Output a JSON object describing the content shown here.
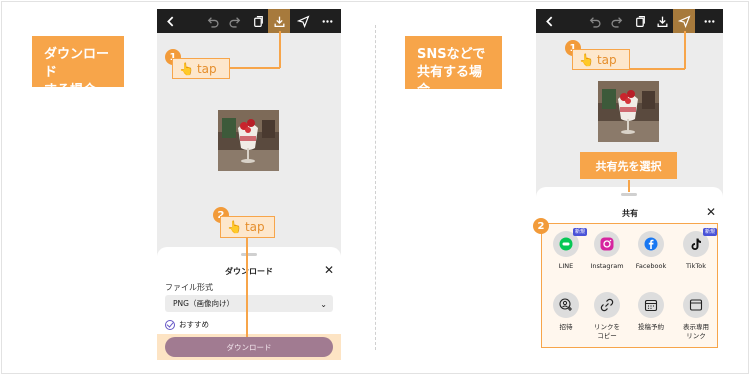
{
  "left_panel": {
    "title_line1": "ダウンロード",
    "title_line2": "する場合",
    "step1": "1",
    "step2": "2",
    "tap_label": "tap",
    "sheet": {
      "title": "ダウンロード",
      "close": "✕",
      "format_label": "ファイル形式",
      "format_value": "PNG（画像向け）",
      "recommended": "おすすめ",
      "download_button": "ダウンロード"
    }
  },
  "right_panel": {
    "title_line1": "SNSなどで",
    "title_line2": "共有する場合",
    "step1": "1",
    "step2": "2",
    "tap_label": "tap",
    "callout": "共有先を選択",
    "sheet": {
      "title": "共有",
      "close": "✕",
      "row1": [
        {
          "label": "LINE",
          "icon": "line-icon",
          "badge": "新規",
          "color": "#06c755"
        },
        {
          "label": "Instagram",
          "icon": "instagram-icon",
          "badge": "",
          "color": "#d6249f"
        },
        {
          "label": "Facebook",
          "icon": "facebook-icon",
          "badge": "",
          "color": "#1877f2"
        },
        {
          "label": "TikTok",
          "icon": "tiktok-icon",
          "badge": "新規",
          "color": "#111111"
        }
      ],
      "row2": [
        {
          "label": "招待",
          "icon": "invite-icon"
        },
        {
          "label1": "リンクを",
          "label2": "コピー",
          "icon": "link-icon"
        },
        {
          "label": "投稿予約",
          "icon": "calendar-icon"
        },
        {
          "label1": "表示専用",
          "label2": "リンク",
          "icon": "view-link-icon"
        }
      ]
    }
  },
  "colors": {
    "accent": "#f7a54a",
    "topbar": "#1f1f1f",
    "highlight_icon": "#a77a3c",
    "download_button": "#a17b91"
  }
}
